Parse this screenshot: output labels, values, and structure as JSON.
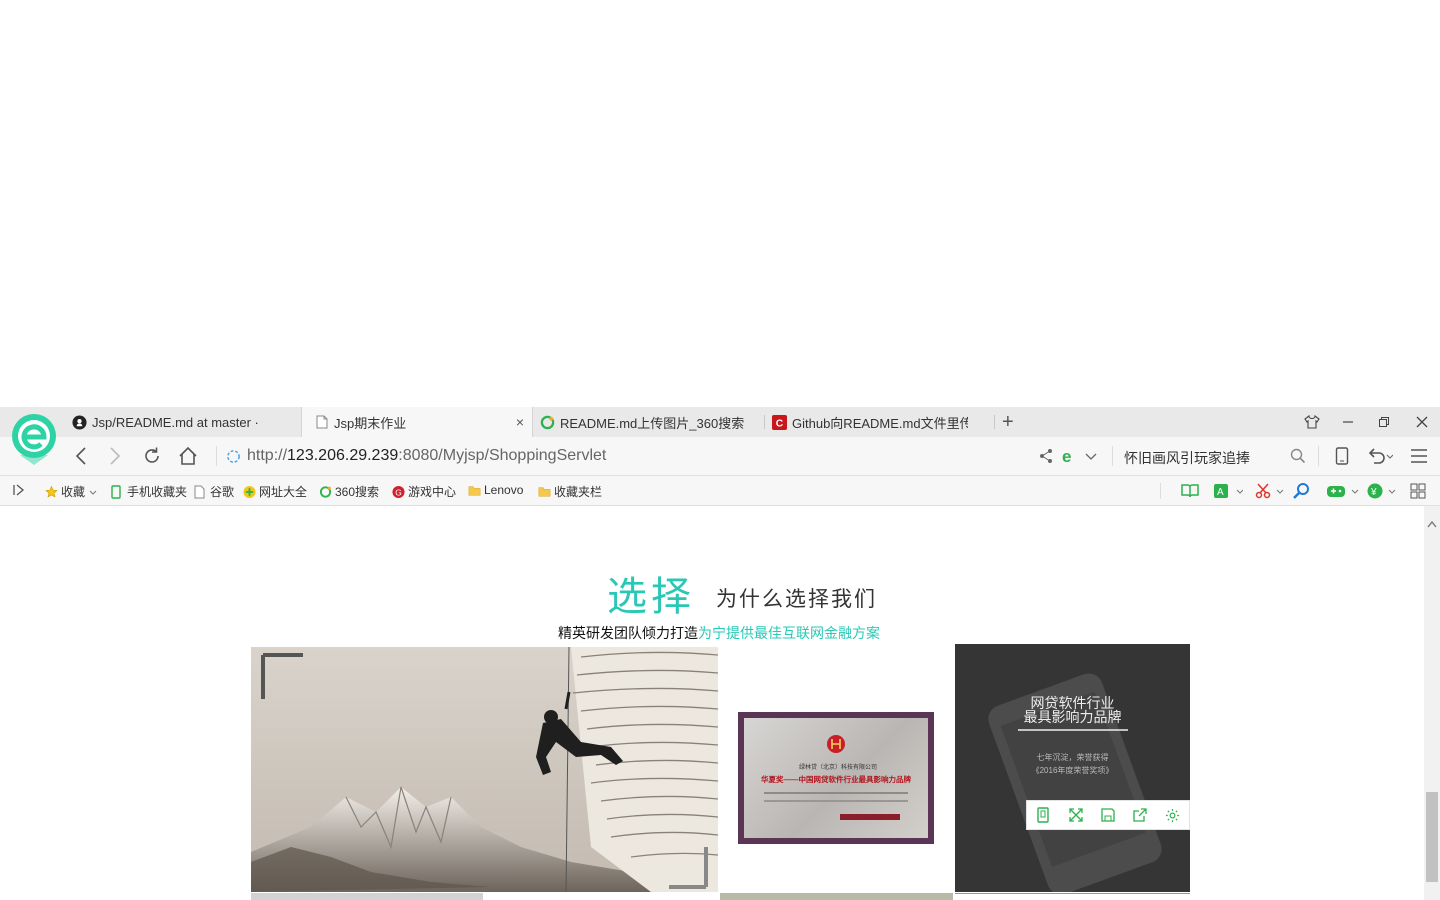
{
  "browser": {
    "tabs": [
      {
        "title": "Jsp/README.md at master · ",
        "icon": "github-icon",
        "active": false
      },
      {
        "title": "Jsp期末作业",
        "icon": "page-icon",
        "active": true
      },
      {
        "title": "README.md上传图片_360搜索",
        "icon": "360-search-icon",
        "active": false
      },
      {
        "title": "Github向README.md文件里传",
        "icon": "csdn-icon",
        "active": false
      }
    ],
    "tab_close": "×",
    "new_tab": "+",
    "url": {
      "scheme": "http://",
      "host": "123.206.29.239",
      "rest": ":8080/Myjsp/ShoppingServlet"
    },
    "search_text": "怀旧画风引玩家追捧",
    "bookmarks": [
      {
        "label": "收藏",
        "icon": "star-icon"
      },
      {
        "label": "手机收藏夹",
        "icon": "phone-icon"
      },
      {
        "label": "谷歌",
        "icon": "page-icon"
      },
      {
        "label": "网址大全",
        "icon": "globe-icon"
      },
      {
        "label": "360搜索",
        "icon": "360-search-icon"
      },
      {
        "label": "游戏中心",
        "icon": "game-center-icon"
      },
      {
        "label": "Lenovo",
        "icon": "folder-icon"
      },
      {
        "label": "收藏夹栏",
        "icon": "folder-icon"
      }
    ]
  },
  "page": {
    "hero_big": "选择",
    "hero_small": "为什么选择我们",
    "subline_plain": "精英研发团队倾力打造",
    "subline_highlight": "为宁提供最佳互联网金融方案",
    "dark_card": {
      "title_line1": "网贷软件行业",
      "title_line2": "最具影响力品牌",
      "desc_line1": "七年沉淀，荣誉获得",
      "desc_line2": "《2016年度荣誉奖项》"
    },
    "cert": {
      "text_top": "华夏奖——中国网贷软件行业最具影响力品牌",
      "text_company": "绿林贷（北京）科技有限公司"
    }
  },
  "colors": {
    "accent": "#29c8b5",
    "tabbar": "#e9e9e9",
    "toolbar": "#f7f7f7"
  }
}
